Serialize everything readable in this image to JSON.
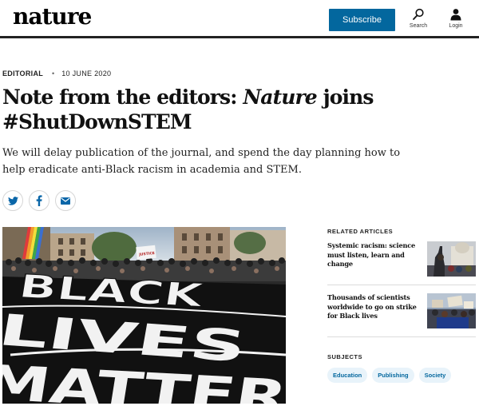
{
  "header": {
    "logo": "nature",
    "subscribe_label": "Subscribe",
    "search_label": "Search",
    "login_label": "Login"
  },
  "article": {
    "type": "EDITORIAL",
    "date": "10 JUNE 2020",
    "title_part1": "Note from the editors: ",
    "title_italic": "Nature",
    "title_part2": " joins #ShutDownSTEM",
    "standfirst": "We will delay publication of the journal, and spend the day planning how to help eradicate anti-Black racism in academia and STEM.",
    "share_icons": [
      "twitter-icon",
      "facebook-icon",
      "email-icon"
    ],
    "hero_banner_lines": [
      "BLACK",
      "LIVES",
      "MATTER"
    ],
    "hero_sign": "JUSTICE"
  },
  "sidebar": {
    "related_heading": "RELATED ARTICLES",
    "related": [
      {
        "title": "Systemic racism: science must listen, learn and change"
      },
      {
        "title": "Thousands of scientists worldwide to go on strike for Black lives"
      }
    ],
    "subjects_heading": "SUBJECTS",
    "subjects": [
      "Education",
      "Publishing",
      "Society"
    ]
  },
  "colors": {
    "brand_blue": "#03679e",
    "tag_bg": "#e8f3fa",
    "text": "#222222"
  }
}
